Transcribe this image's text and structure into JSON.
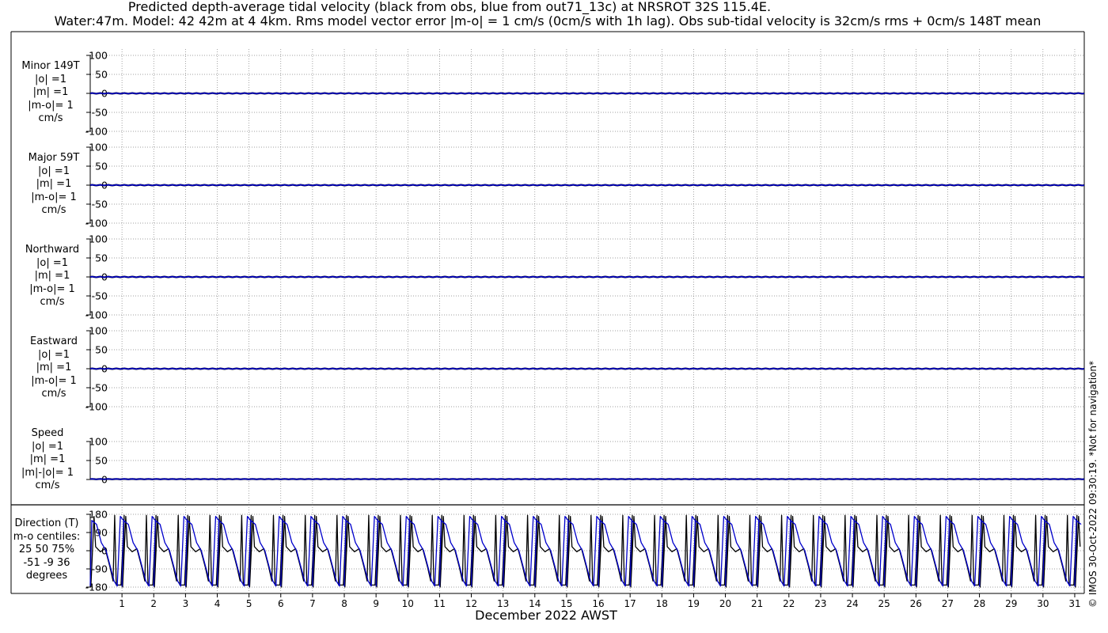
{
  "title_line1": "Predicted depth-average tidal velocity (black from obs, blue from out71_13c) at NRSROT 32S 115.4E.",
  "title_line2": "Water:47m. Model: 42 42m at 4 4km. Rms model vector error |m-o| = 1 cm/s (0cm/s with 1h lag). Obs sub-tidal velocity is 32cm/s rms + 0cm/s 148T mean",
  "copyright": "© IMOS 30-Oct-2022 09:30:19. *Not for navigation*",
  "colors": {
    "obs": "#000000",
    "model": "#0000cc",
    "grid": "#808080"
  },
  "chart_data": [
    {
      "type": "line",
      "label_lines": [
        "Minor 149T",
        "|o| =1",
        "|m| =1",
        "|m-o|= 1",
        "cm/s"
      ],
      "ylim": [
        -100,
        100
      ],
      "yticks": [
        -100,
        -50,
        0,
        50,
        100
      ],
      "ytick_labels": [
        "-100",
        "-50",
        "0",
        "50",
        "100"
      ],
      "grid": true,
      "series": [
        {
          "color": "#000000",
          "values": [
            0,
            0.8,
            0,
            -0.8,
            0,
            0.8,
            0,
            -0.8,
            0
          ]
        },
        {
          "color": "#0000cc",
          "values": [
            0,
            0.9,
            0,
            -0.9,
            0,
            0.9,
            0,
            -0.9,
            0
          ]
        }
      ]
    },
    {
      "type": "line",
      "label_lines": [
        "Major 59T",
        "|o| =1",
        "|m| =1",
        "|m-o|= 1",
        "cm/s"
      ],
      "ylim": [
        -100,
        100
      ],
      "yticks": [
        -100,
        -50,
        0,
        50,
        100
      ],
      "ytick_labels": [
        "-100",
        "-50",
        "0",
        "50",
        "100"
      ],
      "grid": true,
      "series": [
        {
          "color": "#000000",
          "values": [
            0,
            0.8,
            0,
            -0.8,
            0,
            0.8,
            0,
            -0.8,
            0
          ]
        },
        {
          "color": "#0000cc",
          "values": [
            0,
            0.9,
            0,
            -0.9,
            0,
            0.9,
            0,
            -0.9,
            0
          ]
        }
      ]
    },
    {
      "type": "line",
      "label_lines": [
        "Northward",
        "|o| =1",
        "|m| =1",
        "|m-o|= 1",
        "cm/s"
      ],
      "ylim": [
        -100,
        100
      ],
      "yticks": [
        -100,
        -50,
        0,
        50,
        100
      ],
      "ytick_labels": [
        "-100",
        "-50",
        "0",
        "50",
        "100"
      ],
      "grid": true,
      "series": [
        {
          "color": "#000000",
          "values": [
            0,
            0.8,
            0,
            -0.8,
            0,
            0.8,
            0,
            -0.8,
            0
          ]
        },
        {
          "color": "#0000cc",
          "values": [
            0,
            0.9,
            0,
            -0.9,
            0,
            0.9,
            0,
            -0.9,
            0
          ]
        }
      ]
    },
    {
      "type": "line",
      "label_lines": [
        "Eastward",
        "|o| =1",
        "|m| =1",
        "|m-o|= 1",
        "cm/s"
      ],
      "ylim": [
        -100,
        100
      ],
      "yticks": [
        -100,
        -50,
        0,
        50,
        100
      ],
      "ytick_labels": [
        "-100",
        "-50",
        "0",
        "50",
        "100"
      ],
      "grid": true,
      "series": [
        {
          "color": "#000000",
          "values": [
            0,
            0.8,
            0,
            -0.8,
            0,
            0.8,
            0,
            -0.8,
            0
          ]
        },
        {
          "color": "#0000cc",
          "values": [
            0,
            0.9,
            0,
            -0.9,
            0,
            0.9,
            0,
            -0.9,
            0
          ]
        }
      ]
    },
    {
      "type": "line",
      "label_lines": [
        "Speed",
        "|o| =1",
        "|m| =1",
        "|m|-|o|= 1",
        "cm/s"
      ],
      "ylim": [
        0,
        100
      ],
      "yticks": [
        0,
        50,
        100
      ],
      "ytick_labels": [
        "0",
        "50",
        "100"
      ],
      "grid": true,
      "series": [
        {
          "color": "#000000",
          "values": [
            1,
            1.5,
            1,
            0.5,
            1,
            1.5,
            1,
            0.5,
            1
          ]
        },
        {
          "color": "#0000cc",
          "values": [
            1,
            1.6,
            1,
            0.6,
            1,
            1.6,
            1,
            0.6,
            1
          ]
        }
      ]
    },
    {
      "type": "line",
      "label_lines": [
        "Direction (T)",
        "m-o centiles:",
        "25  50  75%",
        "-51  -9  36",
        "degrees"
      ],
      "ylim": [
        -180,
        180
      ],
      "yticks": [
        -180,
        -90,
        0,
        90,
        180
      ],
      "ytick_labels": [
        "-180",
        "-90",
        "0",
        "90",
        "180"
      ],
      "grid": true,
      "series": [
        {
          "color": "#000000",
          "name": "obs direction",
          "values": [
            {
              "x": 0.0,
              "y": -180
            },
            {
              "x": 0.1,
              "y": 170
            },
            {
              "x": 0.15,
              "y": 20
            },
            {
              "x": 0.3,
              "y": -5
            },
            {
              "x": 0.45,
              "y": 10
            },
            {
              "x": 0.6,
              "y": -80
            },
            {
              "x": 0.7,
              "y": -150
            },
            {
              "x": 0.75,
              "y": 175
            },
            {
              "x": 0.8,
              "y": -170
            },
            {
              "x": 0.95,
              "y": -170
            },
            {
              "x": 1.05,
              "y": 175
            }
          ],
          "period_days": 1.0,
          "days": [
            0,
            31
          ]
        },
        {
          "color": "#0000cc",
          "name": "model direction",
          "values": [
            {
              "x": 0.0,
              "y": -175
            },
            {
              "x": 0.05,
              "y": 150
            },
            {
              "x": 0.2,
              "y": 130
            },
            {
              "x": 0.35,
              "y": 40
            },
            {
              "x": 0.5,
              "y": 0
            },
            {
              "x": 0.6,
              "y": -60
            },
            {
              "x": 0.75,
              "y": -150
            },
            {
              "x": 0.85,
              "y": -175
            },
            {
              "x": 0.95,
              "y": 170
            },
            {
              "x": 1.05,
              "y": 150
            }
          ],
          "period_days": 1.0,
          "days": [
            0,
            31
          ]
        }
      ]
    }
  ],
  "x_axis": {
    "label": "December 2022 AWST",
    "xlim": [
      0,
      31.3
    ],
    "ticks": [
      1,
      2,
      3,
      4,
      5,
      6,
      7,
      8,
      9,
      10,
      11,
      12,
      13,
      14,
      15,
      16,
      17,
      18,
      19,
      20,
      21,
      22,
      23,
      24,
      25,
      26,
      27,
      28,
      29,
      30,
      31
    ],
    "tick_labels": [
      "1",
      "2",
      "3",
      "4",
      "5",
      "6",
      "7",
      "8",
      "9",
      "10",
      "11",
      "12",
      "13",
      "14",
      "15",
      "16",
      "17",
      "18",
      "19",
      "20",
      "21",
      "22",
      "23",
      "24",
      "25",
      "26",
      "27",
      "28",
      "29",
      "30",
      "31"
    ]
  }
}
